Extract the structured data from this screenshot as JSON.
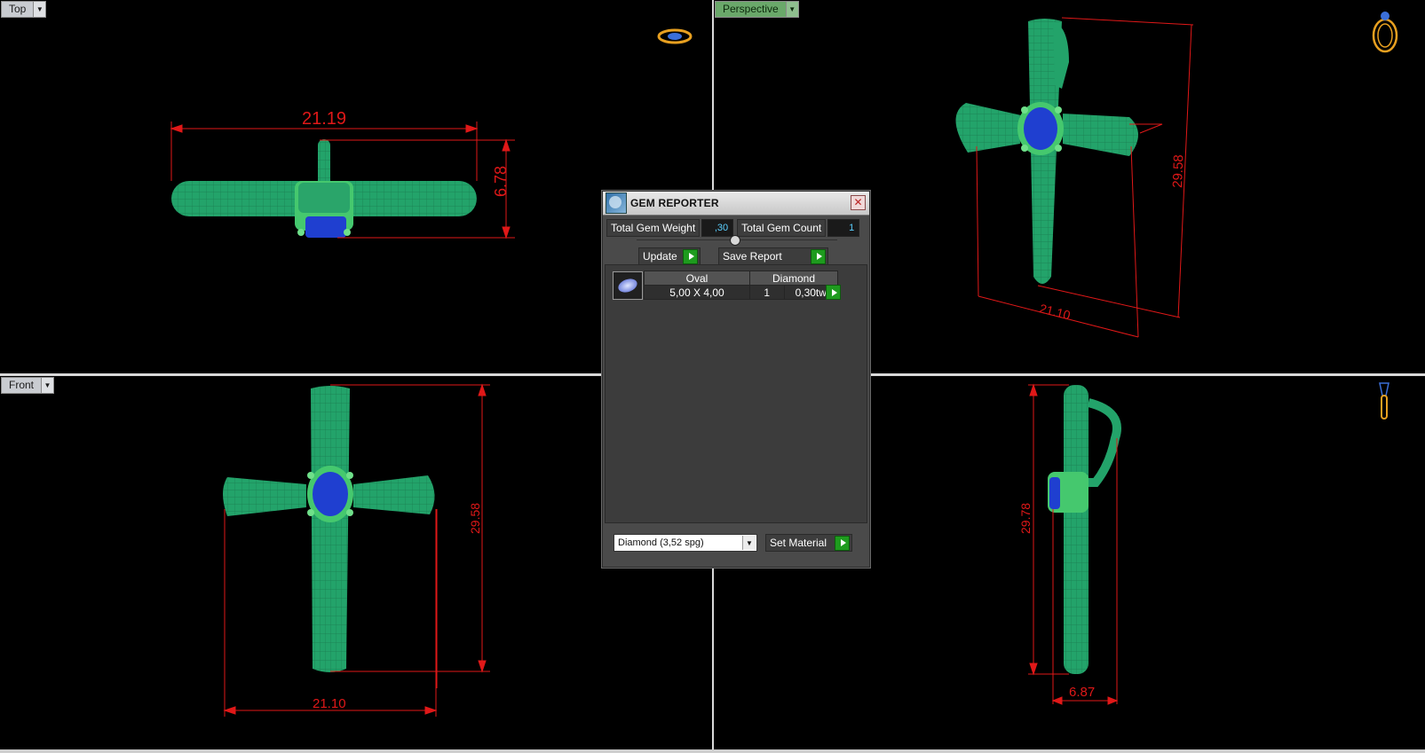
{
  "viewports": {
    "top": {
      "tab_label": "Top",
      "dims": {
        "width": "21.19",
        "height": "6.78"
      }
    },
    "perspective": {
      "tab_label": "Perspective",
      "dims": {
        "height": "29.58",
        "width": "21.10"
      }
    },
    "front": {
      "tab_label": "Front",
      "dims": {
        "height": "29.58",
        "width": "21.10"
      }
    },
    "side": {
      "dims": {
        "height": "29.78",
        "width": "6.87"
      }
    }
  },
  "gem_reporter": {
    "title": "GEM REPORTER",
    "total_gem_weight_label": "Total Gem Weight",
    "total_gem_weight_value": ",30",
    "total_gem_count_label": "Total Gem Count",
    "total_gem_count_value": "1",
    "update_label": "Update",
    "save_report_label": "Save Report",
    "table": {
      "headers": [
        "Oval",
        "Diamond"
      ],
      "row": {
        "size": "5,00 X 4,00",
        "count": "1",
        "weight": "0,30tw"
      }
    },
    "material_select": "Diamond    (3,52 spg)",
    "set_material_label": "Set Material"
  },
  "colors": {
    "metal": "#27a56a",
    "gem": "#1f3fd0",
    "dimension": "#e01818",
    "background": "#000000"
  }
}
